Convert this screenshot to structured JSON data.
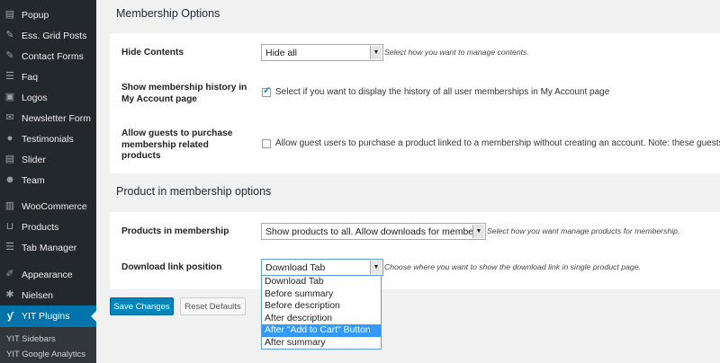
{
  "sidebar": {
    "items": [
      {
        "label": "Popup",
        "icon": "page-icon"
      },
      {
        "label": "Ess. Grid Posts",
        "icon": "pin-icon"
      },
      {
        "label": "Contact Forms",
        "icon": "pin-icon"
      },
      {
        "label": "Faq",
        "icon": "list-icon"
      },
      {
        "label": "Logos",
        "icon": "image-icon"
      },
      {
        "label": "Newsletter Form",
        "icon": "mail-icon"
      },
      {
        "label": "Testimonials",
        "icon": "comment-icon"
      },
      {
        "label": "Slider",
        "icon": "page-icon"
      },
      {
        "label": "Team",
        "icon": "people-icon"
      },
      {
        "label": "WooCommerce",
        "icon": "woo-icon"
      },
      {
        "label": "Products",
        "icon": "cart-icon"
      },
      {
        "label": "Tab Manager",
        "icon": "list-icon"
      },
      {
        "label": "Appearance",
        "icon": "brush-icon"
      },
      {
        "label": "Nielsen",
        "icon": "wrench-icon"
      },
      {
        "label": "YIT Plugins",
        "icon": "yit-icon"
      }
    ],
    "submenu": [
      "YIT Sidebars",
      "YIT Google Analytics"
    ],
    "colors": {
      "background": "#23282d",
      "active": "#0073aa"
    }
  },
  "membership": {
    "title": "Membership Options",
    "hide_contents": {
      "label": "Hide Contents",
      "value": "Hide all",
      "description": "Select how you want to manage contents."
    },
    "history": {
      "label_line1": "Show membership history in",
      "label_line2": "My Account page",
      "checked": true,
      "text": "Select if you want to display the history of all user memberships in My Account page"
    },
    "guests": {
      "label_line1": "Allow guests to purchase",
      "label_line2": "membership related",
      "label_line3": "products",
      "checked": false,
      "text": "Allow guest users to purchase a product linked to a membership without creating an account. Note: these guests"
    }
  },
  "products": {
    "title": "Product in membership options",
    "products_in_membership": {
      "label": "Products in membership",
      "value": "Show products to all. Allow downloads for members",
      "description": "Select how you want manage products for membership."
    },
    "download_link": {
      "label": "Download link position",
      "value": "Download Tab",
      "description": "Choose where you want to show the download link in single product page.",
      "options": [
        "Download Tab",
        "Before summary",
        "Before description",
        "After description",
        "After \"Add to Cart\" Button",
        "After summary"
      ],
      "highlighted": "After \"Add to Cart\" Button"
    }
  },
  "buttons": {
    "save": "Save Changes",
    "reset": "Reset Defaults"
  },
  "colors": {
    "primary_button": "#0085ba",
    "highlight": "#3399ff",
    "checkmark": "#1e8cbe"
  }
}
